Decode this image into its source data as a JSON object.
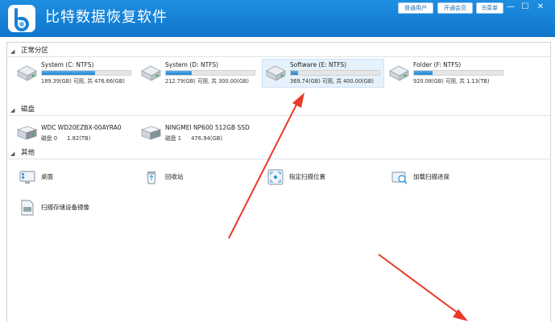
{
  "app": {
    "title": "比特数据恢复软件"
  },
  "titlebar": {
    "buttons": [
      "普通用户",
      "开通会员",
      "菜单"
    ],
    "window_controls": [
      "minimize-icon",
      "maximize-icon",
      "close-icon"
    ]
  },
  "sections": {
    "partitions": {
      "label": "正常分区"
    },
    "disks": {
      "label": "磁盘"
    },
    "other": {
      "label": "其他"
    }
  },
  "partitions": [
    {
      "name": "System (C: NTFS)",
      "used": "189.39(GB)",
      "available": "可用",
      "total_prefix": "共",
      "total": "476.66(GB)",
      "usage": 0.6,
      "selected": false
    },
    {
      "name": "System (D: NTFS)",
      "used": "212.79(GB)",
      "available": "可用",
      "total_prefix": "共",
      "total": "300.00(GB)",
      "usage": 0.29,
      "selected": false
    },
    {
      "name": "Software (E: NTFS)",
      "used": "369.74(GB)",
      "available": "可用",
      "total_prefix": "共",
      "total": "400.00(GB)",
      "usage": 0.08,
      "selected": true
    },
    {
      "name": "Folder (F: NTFS)",
      "used": "920.08(GB)",
      "available": "可用",
      "total_prefix": "共",
      "total": "1.13(TB)",
      "usage": 0.21,
      "selected": false
    }
  ],
  "disks": [
    {
      "name": "WDC WD20EZBX-00AYRA0",
      "disk_label": "磁盘 0",
      "size": "1.82(TB)"
    },
    {
      "name": "NINGMEI NP600 512GB SSD",
      "disk_label": "磁盘 1",
      "size": "476.94(GB)"
    }
  ],
  "other_items": [
    {
      "label": "桌面",
      "icon": "desktop-icon"
    },
    {
      "label": "回收站",
      "icon": "recycle-bin-icon"
    },
    {
      "label": "指定扫描位置",
      "icon": "scan-location-icon"
    },
    {
      "label": "加载扫描进度",
      "icon": "load-scan-icon"
    },
    {
      "label": "扫描存储设备镜像",
      "icon": "disk-image-icon"
    }
  ],
  "colors": {
    "titlebar": "#1582d8",
    "bar_fill": "#2a8ad6",
    "arrow": "#e8392a",
    "selected_bg": "#e5f1fb"
  }
}
